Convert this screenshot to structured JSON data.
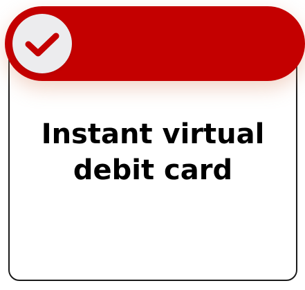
{
  "feature": {
    "title_line1": "Instant virtual",
    "title_line2": "debit card",
    "icon": "check-circle-icon",
    "colors": {
      "banner": "#c40000",
      "check": "#c40000",
      "circle": "#ececee",
      "border": "#1a1a1a",
      "text": "#000000"
    }
  }
}
